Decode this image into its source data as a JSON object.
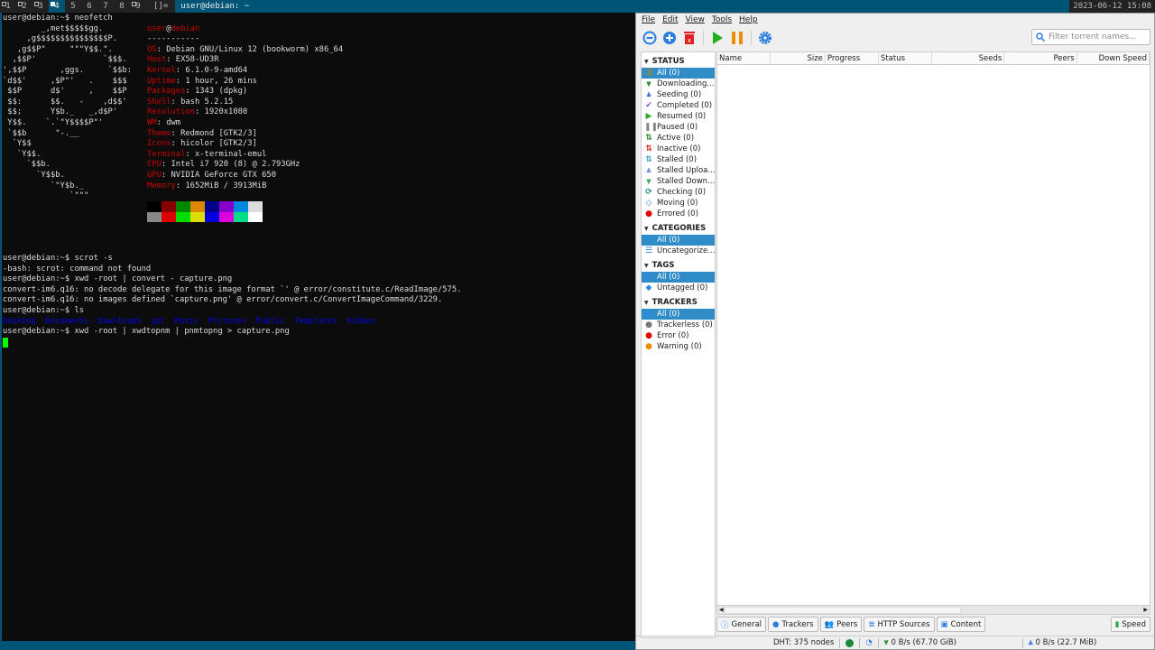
{
  "bar": {
    "tags": [
      "1",
      "2",
      "3",
      "4",
      "5",
      "6",
      "7",
      "8",
      "9"
    ],
    "occupied": [
      true,
      true,
      true,
      true,
      false,
      false,
      false,
      false,
      true
    ],
    "selected_tag": "4",
    "layout": "[]=",
    "window_title": "user@debian: ~",
    "clock": "2023-06-12 15:08"
  },
  "terminal": {
    "prompt1": "user@debian:~$ neofetch",
    "logo": [
      "        _,met$$$$$gg.",
      "     ,g$$$$$$$$$$$$$$$P.",
      "   ,g$$P\"     \"\"\"Y$$.\".",
      "  ,$$P'              `$$$.",
      "',$$P       ,ggs.     `$$b:",
      "`d$$'     ,$P\"'   .    $$$",
      " $$P      d$'     ,    $$P",
      " $$:      $$.   -    ,d$$'",
      " $$;      Y$b._   _,d$P'",
      " Y$$.    `.`\"Y$$$$P\"'",
      " `$$b      \"-.__",
      "  `Y$$",
      "   `Y$$.",
      "     `$$b.",
      "       `Y$$b.",
      "          `\"Y$b._",
      "              `\"\"\""
    ],
    "user": "user",
    "at": "@",
    "host": "debian",
    "rule": "-----------",
    "info": [
      {
        "k": "OS",
        "v": "Debian GNU/Linux 12 (bookworm) x86_64"
      },
      {
        "k": "Host",
        "v": "EX58-UD3R"
      },
      {
        "k": "Kernel",
        "v": "6.1.0-9-amd64"
      },
      {
        "k": "Uptime",
        "v": "1 hour, 26 mins"
      },
      {
        "k": "Packages",
        "v": "1343 (dpkg)"
      },
      {
        "k": "Shell",
        "v": "bash 5.2.15"
      },
      {
        "k": "Resolution",
        "v": "1920x1080"
      },
      {
        "k": "WM",
        "v": "dwm"
      },
      {
        "k": "Theme",
        "v": "Redmond [GTK2/3]"
      },
      {
        "k": "Icons",
        "v": "hicolor [GTK2/3]"
      },
      {
        "k": "Terminal",
        "v": "x-terminal-emul"
      },
      {
        "k": "CPU",
        "v": "Intel i7 920 (8) @ 2.793GHz"
      },
      {
        "k": "GPU",
        "v": "NVIDIA GeForce GTX 650"
      },
      {
        "k": "Memory",
        "v": "1652MiB / 3913MiB"
      }
    ],
    "palette_top": [
      "#000000",
      "#880000",
      "#008800",
      "#dd8800",
      "#000088",
      "#8800cc",
      "#0088dd",
      "#dddddd"
    ],
    "palette_bottom": [
      "#888888",
      "#dd0000",
      "#00dd00",
      "#dddd00",
      "#0000dd",
      "#dd00dd",
      "#00dd88",
      "#ffffff"
    ],
    "lines": [
      "user@debian:~$ scrot -s",
      "-bash: scrot: command not found",
      "user@debian:~$ xwd -root | convert - capture.png",
      "convert-im6.q16: no decode delegate for this image format `' @ error/constitute.c/ReadImage/575.",
      "convert-im6.q16: no images defined `capture.png' @ error/convert.c/ConvertImageCommand/3229.",
      "user@debian:~$ ls"
    ],
    "ls": [
      "Desktop",
      "Documents",
      "Downloads",
      "git",
      "Music",
      "Pictures",
      "Public",
      "Templates",
      "Videos"
    ],
    "last": "user@debian:~$ xwd -root | xwdtopnm | pnmtopng > capture.png"
  },
  "qb": {
    "menu": [
      "File",
      "Edit",
      "View",
      "Tools",
      "Help"
    ],
    "filter_placeholder": "Filter torrent names...",
    "sections": [
      {
        "title": "STATUS",
        "items": [
          {
            "label": "All (0)",
            "icon": "shuffle-icon",
            "color": "#b8860b",
            "glyph": "⤮"
          },
          {
            "label": "Downloading...",
            "icon": "download-icon",
            "color": "#1a7f1a",
            "glyph": "⩔"
          },
          {
            "label": "Seeding (0)",
            "icon": "upload-icon",
            "color": "#2a6adf",
            "glyph": "⩓"
          },
          {
            "label": "Completed (0)",
            "icon": "check-icon",
            "color": "#8a4fd8",
            "glyph": "✔"
          },
          {
            "label": "Resumed (0)",
            "icon": "play-icon",
            "color": "#22aa22",
            "glyph": "▶"
          },
          {
            "label": "Paused (0)",
            "icon": "pause-icon",
            "color": "#888888",
            "glyph": "❚❚"
          },
          {
            "label": "Active (0)",
            "icon": "active-icon",
            "color": "#2a8a2a",
            "glyph": "⇅"
          },
          {
            "label": "Inactive (0)",
            "icon": "inactive-icon",
            "color": "#e02020",
            "glyph": "⇅"
          },
          {
            "label": "Stalled (0)",
            "icon": "stalled-icon",
            "color": "#3aa0d0",
            "glyph": "⇅"
          },
          {
            "label": "Stalled Uploa...",
            "icon": "stalled-upload-icon",
            "color": "#5a8ae0",
            "glyph": "⩓"
          },
          {
            "label": "Stalled Down...",
            "icon": "stalled-download-icon",
            "color": "#30a050",
            "glyph": "⩔"
          },
          {
            "label": "Checking (0)",
            "icon": "refresh-icon",
            "color": "#1a8a8a",
            "glyph": "⟳"
          },
          {
            "label": "Moving (0)",
            "icon": "moving-icon",
            "color": "#2a8ae0",
            "glyph": "◇"
          },
          {
            "label": "Errored (0)",
            "icon": "error-icon",
            "color": "#e00000",
            "glyph": "●"
          }
        ]
      },
      {
        "title": "CATEGORIES",
        "items": [
          {
            "label": "All (0)",
            "icon": "list-icon",
            "color": "#2a8ae0",
            "glyph": "☰"
          },
          {
            "label": "Uncategorize...",
            "icon": "list-icon",
            "color": "#2a8ae0",
            "glyph": "☰"
          }
        ]
      },
      {
        "title": "TAGS",
        "items": [
          {
            "label": "All (0)",
            "icon": "tag-icon",
            "color": "#2a8ae0",
            "glyph": "◆"
          },
          {
            "label": "Untagged (0)",
            "icon": "tag-icon",
            "color": "#2a8ae0",
            "glyph": "◆"
          }
        ]
      },
      {
        "title": "TRACKERS",
        "items": [
          {
            "label": "All (0)",
            "icon": "pin-icon",
            "color": "#2a8ae0",
            "glyph": "●"
          },
          {
            "label": "Trackerless (0)",
            "icon": "pin-icon",
            "color": "#777777",
            "glyph": "●"
          },
          {
            "label": "Error (0)",
            "icon": "pin-icon",
            "color": "#e00000",
            "glyph": "●"
          },
          {
            "label": "Warning (0)",
            "icon": "pin-icon",
            "color": "#f08c00",
            "glyph": "●"
          }
        ]
      }
    ],
    "columns": [
      "Name",
      "Size",
      "Progress",
      "Status",
      "Seeds",
      "Peers",
      "Down Speed"
    ],
    "tabs": [
      "General",
      "Trackers",
      "Peers",
      "HTTP Sources",
      "Content"
    ],
    "speed_tab": "Speed",
    "status": {
      "dht": "DHT: 375 nodes",
      "down": "0 B/s (67.70 GiB)",
      "up": "0 B/s (22.7 MiB)"
    }
  }
}
